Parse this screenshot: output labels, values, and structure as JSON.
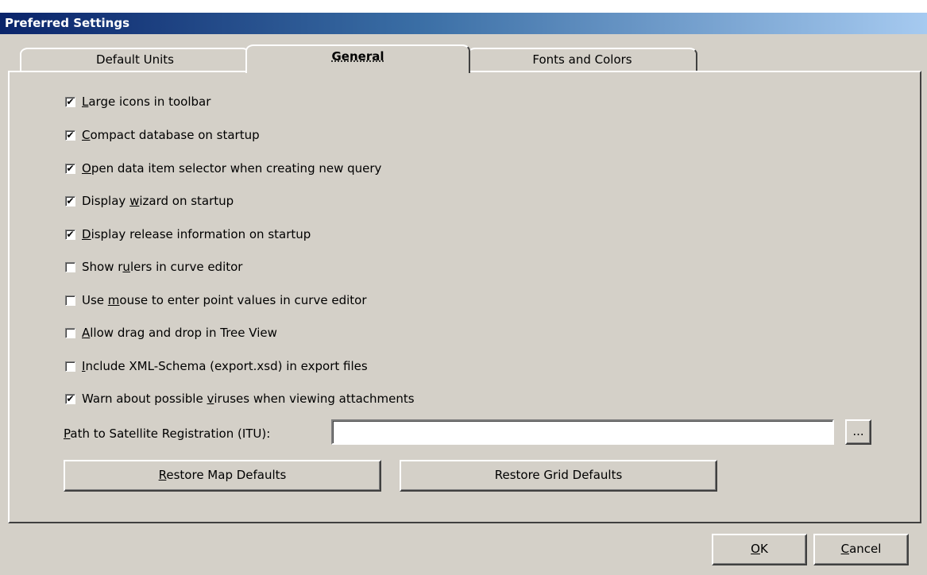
{
  "window": {
    "title": "Preferred Settings"
  },
  "tabs": [
    {
      "label": "Default Units"
    },
    {
      "label": "General"
    },
    {
      "label": "Fonts and Colors"
    }
  ],
  "options": [
    {
      "pre": "",
      "key": "L",
      "post": "arge icons in toolbar",
      "checked": true
    },
    {
      "pre": "",
      "key": "C",
      "post": "ompact database on startup",
      "checked": true
    },
    {
      "pre": "",
      "key": "O",
      "post": "pen data item selector when creating new query",
      "checked": true
    },
    {
      "pre": "Display ",
      "key": "w",
      "post": "izard on startup",
      "checked": true
    },
    {
      "pre": "",
      "key": "D",
      "post": "isplay release information on startup",
      "checked": true
    },
    {
      "pre": "Show r",
      "key": "u",
      "post": "lers in curve editor",
      "checked": false
    },
    {
      "pre": "Use ",
      "key": "m",
      "post": "ouse to enter point values in curve editor",
      "checked": false
    },
    {
      "pre": "",
      "key": "A",
      "post": "llow drag and drop in Tree View",
      "checked": false
    },
    {
      "pre": "",
      "key": "I",
      "post": "nclude XML-Schema (export.xsd) in export files",
      "checked": false
    },
    {
      "pre": "Warn about possible ",
      "key": "v",
      "post": "iruses when viewing attachments",
      "checked": true
    }
  ],
  "path": {
    "label_key": "P",
    "label_rest": "ath to Satellite Registration (ITU):",
    "value": "",
    "browse_label": "..."
  },
  "buttons": {
    "restore_map_key": "R",
    "restore_map_rest": "estore Map Defaults",
    "restore_grid": "Restore Grid Defaults",
    "ok_key": "O",
    "ok_rest": "K",
    "cancel_key": "C",
    "cancel_rest": "ancel"
  }
}
